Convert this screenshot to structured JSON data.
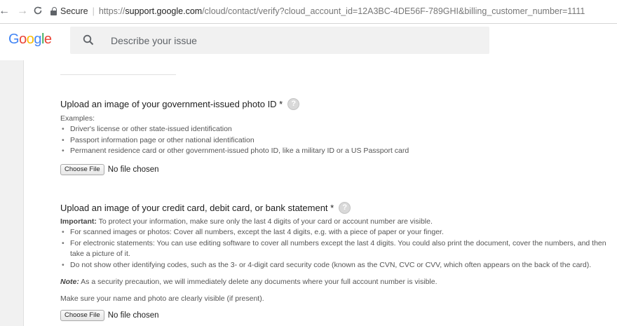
{
  "browser": {
    "secure_label": "Secure",
    "url_scheme": "https://",
    "url_host": "support.google.com",
    "url_rest": "/cloud/contact/verify?cloud_account_id=12A3BC-4DE56F-789GHI&billing_customer_number=1111"
  },
  "header": {
    "logo_letters": [
      "G",
      "o",
      "o",
      "g",
      "l",
      "e"
    ],
    "search_placeholder": "Describe your issue"
  },
  "id_section": {
    "title": "Upload an image of your government-issued photo ID *",
    "examples_label": "Examples:",
    "examples": [
      "Driver's license or other state-issued identification",
      "Passport information page or other national identification",
      "Permanent residence card or other government-issued photo ID, like a military ID or a US Passport card"
    ],
    "choose_button": "Choose File",
    "file_status": "No file chosen"
  },
  "card_section": {
    "title": "Upload an image of your credit card, debit card, or bank statement *",
    "important_label": "Important:",
    "important_text": " To protect your information, make sure only the last 4 digits of your card or account number are visible.",
    "bullets": [
      "For scanned images or photos: Cover all numbers, except the last 4 digits, e.g. with a piece of paper or your finger.",
      "For electronic statements: You can use editing software to cover all numbers except the last 4 digits. You could also print the document, cover the numbers, and then take a picture of it.",
      "Do not show other identifying codes, such as the 3- or 4-digit card security code (known as the CVN, CVC or CVV, which often appears on the back of the card)."
    ],
    "note_label": "Note:",
    "note_text": " As a security precaution, we will immediately delete any documents where your full account number is visible.",
    "visibility_text": "Make sure your name and photo are clearly visible (if present).",
    "choose_button": "Choose File",
    "file_status": "No file chosen"
  },
  "colors": {
    "logo": [
      "#4285F4",
      "#EA4335",
      "#FBBC05",
      "#4285F4",
      "#34A853",
      "#EA4335"
    ]
  }
}
